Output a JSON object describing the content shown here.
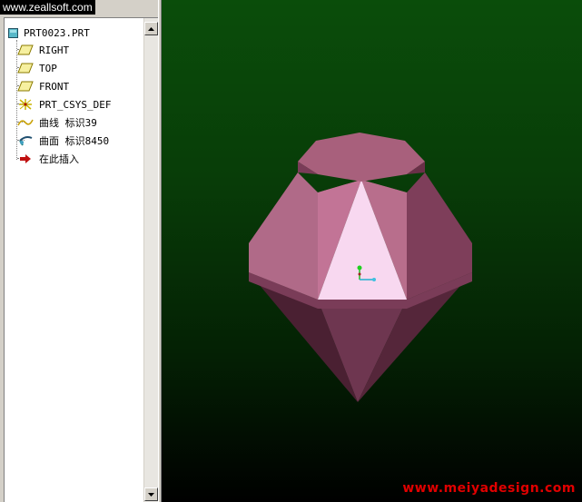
{
  "watermarks": {
    "top": "www.zeallsoft.com",
    "bottom": "www.meiyadesign.com"
  },
  "model_tree": {
    "root": {
      "label": "PRT0023.PRT",
      "icon": "part-icon"
    },
    "items": [
      {
        "label": "RIGHT",
        "icon": "datum-plane-icon"
      },
      {
        "label": "TOP",
        "icon": "datum-plane-icon"
      },
      {
        "label": "FRONT",
        "icon": "datum-plane-icon"
      },
      {
        "label": "PRT_CSYS_DEF",
        "icon": "coordinate-system-icon"
      },
      {
        "label": "曲线 标识39",
        "icon": "curve-icon"
      },
      {
        "label": "曲面 标识8450",
        "icon": "surface-icon"
      },
      {
        "label": "在此插入",
        "icon": "insert-here-arrow-icon"
      }
    ]
  },
  "colors": {
    "viewport_top": "#0a4d0a",
    "viewport_bottom": "#000000",
    "gem": "#b0607a",
    "watermark": "#e00000"
  }
}
